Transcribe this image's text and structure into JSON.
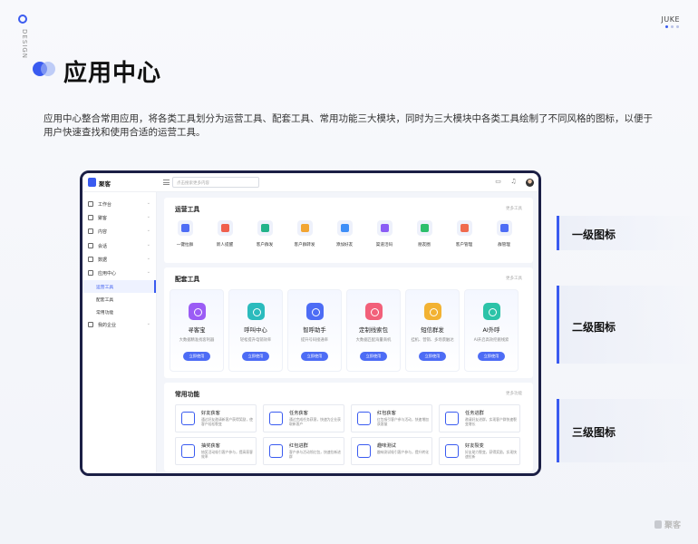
{
  "brand": {
    "corner_label": "JUKE",
    "side_label": "DESIGN",
    "footer_brand": "聚客"
  },
  "page": {
    "title": "应用中心",
    "description": "应用中心整合常用应用，将各类工具划分为运营工具、配套工具、常用功能三大模块，同时为三大模块中各类工具绘制了不同风格的图标，以便于用户快速查找和使用合适的运营工具。"
  },
  "app": {
    "logo_text": "聚客",
    "search_placeholder": "点击搜索更多内容",
    "sidebar": [
      {
        "label": "工作台",
        "icon": "monitor-icon"
      },
      {
        "label": "聚客",
        "icon": "user-icon"
      },
      {
        "label": "内容",
        "icon": "content-icon"
      },
      {
        "label": "会话",
        "icon": "chat-icon"
      },
      {
        "label": "数据",
        "icon": "data-icon"
      },
      {
        "label": "应用中心",
        "icon": "grid-icon"
      }
    ],
    "sidebar_sub": [
      "运营工具",
      "配套工具",
      "常用功能"
    ],
    "sidebar_last": {
      "label": "我的企业",
      "icon": "building-icon"
    },
    "ops_title": "运营工具",
    "ops_more": "更多工具",
    "ops_tools": [
      {
        "label": "一键拉群",
        "color": "#4d6cf5"
      },
      {
        "label": "新人提醒",
        "color": "#f0604d"
      },
      {
        "label": "客户群发",
        "color": "#22b38a"
      },
      {
        "label": "客户群转发",
        "color": "#f2a533"
      },
      {
        "label": "添加好友",
        "color": "#3e8ef7"
      },
      {
        "label": "渠道活码",
        "color": "#8a5cf5"
      },
      {
        "label": "朋友圈",
        "color": "#2dbf6c"
      },
      {
        "label": "客户管理",
        "color": "#f06a4d"
      },
      {
        "label": "群管理",
        "color": "#4d6cf5"
      }
    ],
    "support_title": "配套工具",
    "support_more": "更多工具",
    "support_tools": [
      {
        "title": "寻客宝",
        "desc": "大数据精准找客利器",
        "button": "立即使用",
        "color": "#9b5cf5"
      },
      {
        "title": "呼叫中心",
        "desc": "轻松提升电销效率",
        "button": "立即使用",
        "color": "#2bbbbd"
      },
      {
        "title": "智呼助手",
        "desc": "提升号码接通率",
        "button": "立即使用",
        "color": "#4d6cf5"
      },
      {
        "title": "定制线索包",
        "desc": "大数据匹配海量商机",
        "button": "立即使用",
        "color": "#f2607a"
      },
      {
        "title": "短信群发",
        "desc": "挂机、营销、多场景触达",
        "button": "立即使用",
        "color": "#f2b233"
      },
      {
        "title": "AI外呼",
        "desc": "AI开启高效挖掘线索",
        "button": "立即使用",
        "color": "#2cc3a8"
      }
    ],
    "common_title": "常用功能",
    "common_more": "更多功能",
    "common_features": [
      {
        "title": "好友获客",
        "desc": "通过好友邀请新客户获得奖励，使客户轻松裂变"
      },
      {
        "title": "任务获客",
        "desc": "通过完成任务获客，快速为企业获取新客户"
      },
      {
        "title": "红包获客",
        "desc": "红包吸引客户参与活动，快速增加获客量"
      },
      {
        "title": "任务进群",
        "desc": "邀请好友进群，实现客户群快速裂变增长"
      },
      {
        "title": "抽奖获客",
        "desc": "抽奖活动吸引客户参与，提高获客效率"
      },
      {
        "title": "红包进群",
        "desc": "客户参与活动领红包，快速拉新进群"
      },
      {
        "title": "趣味测试",
        "desc": "趣味测试吸引客户参与，提升转化"
      },
      {
        "title": "好友裂变",
        "desc": "好友助力裂变，获得奖励，实现快速拉新"
      }
    ]
  },
  "levels": [
    "一级图标",
    "二级图标",
    "三级图标"
  ]
}
